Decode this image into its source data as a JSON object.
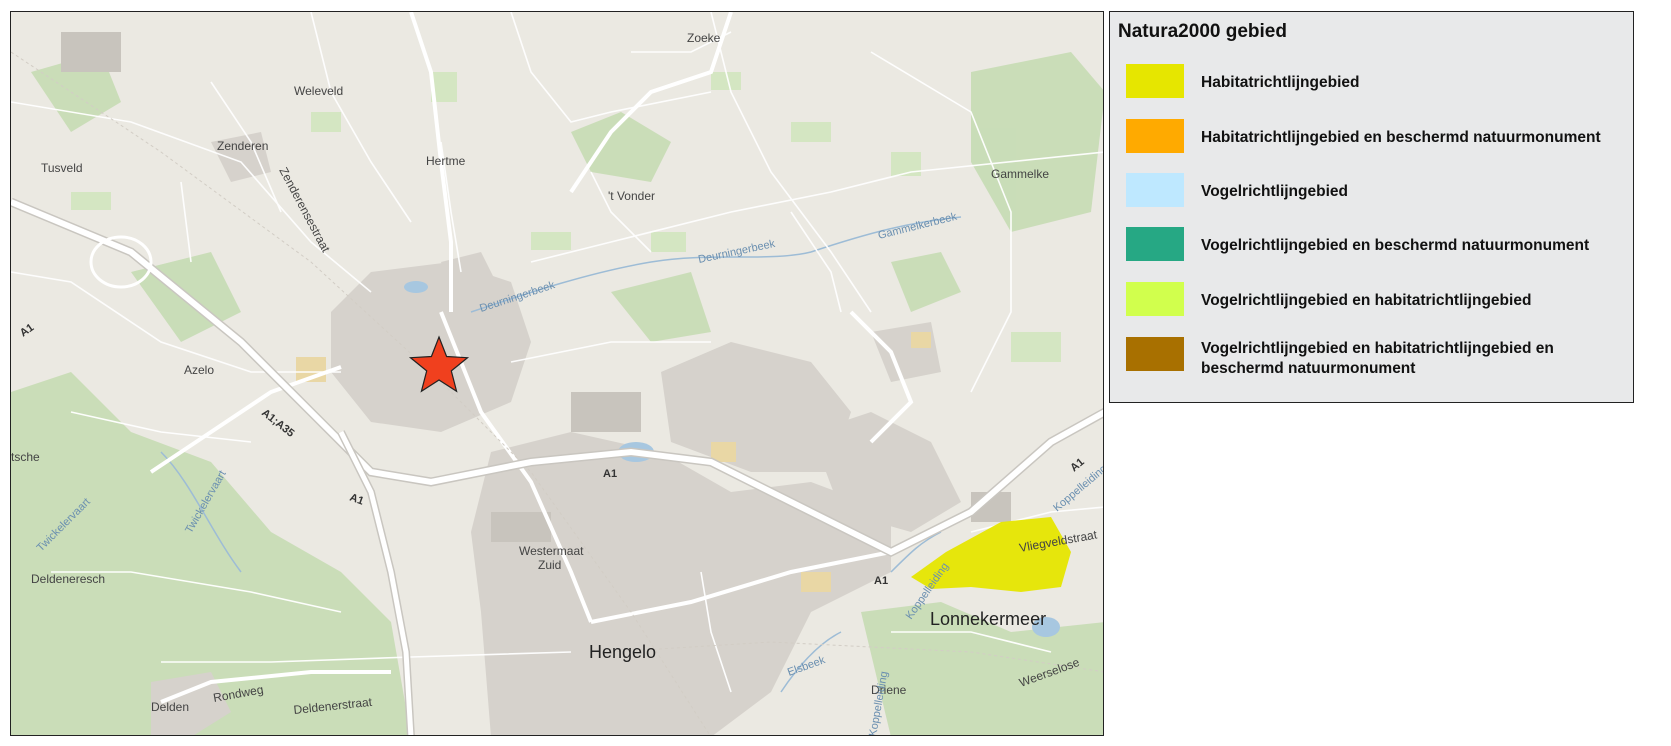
{
  "legend": {
    "title": "Natura2000 gebied",
    "items": [
      {
        "label": "Habitatrichtlijngebied",
        "color": "#e6e600"
      },
      {
        "label": "Habitatrichtlijngebied en beschermd natuurmonument",
        "color": "#ffaa00"
      },
      {
        "label": "Vogelrichtlijngebied",
        "color": "#bee8ff"
      },
      {
        "label": "Vogelrichtlijngebied en beschermd natuurmonument",
        "color": "#26a884"
      },
      {
        "label": "Vogelrichtlijngebied en habitatrichtlijngebied",
        "color": "#d1ff4d"
      },
      {
        "label": "Vogelrichtlijngebied en habitatrichtlijngebied en beschermd natuurmonument",
        "color": "#a87000"
      }
    ]
  },
  "map": {
    "places": {
      "zoeke": "Zoeke",
      "weleveld": "Weleveld",
      "zenderen": "Zenderen",
      "tusveld": "Tusveld",
      "hertme": "Hertme",
      "t_vonder": "'t Vonder",
      "gammelke": "Gammelke",
      "azelo": "Azelo",
      "tsche": "tsche",
      "westermaat": "Westermaat",
      "zuid": "Zuid",
      "hengelo": "Hengelo",
      "deldeneresch": "Deldeneresch",
      "delden": "Delden",
      "driene": "Driene",
      "lonnekermeer": "Lonnekermeer"
    },
    "streets": {
      "zenderensestraat": "Zenderensestraat",
      "deldenerstraat": "Deldenerstraat",
      "rondweg": "Rondweg",
      "vliegveldstraat": "Vliegveldstraat",
      "weerselose": "Weerselose"
    },
    "waters": {
      "deurningerbeek": "Deurningerbeek",
      "gammelkerbeek": "Gammelkerbeek",
      "twickelervaart": "Twickelervaart",
      "elsbeek": "Elsbeek",
      "koppelleiding": "Koppelleiding"
    },
    "roads": {
      "a1": "A1",
      "a1_a35": "A1;A35"
    },
    "marker_icon": "star-icon",
    "natura_area_color": "#e6e600"
  }
}
